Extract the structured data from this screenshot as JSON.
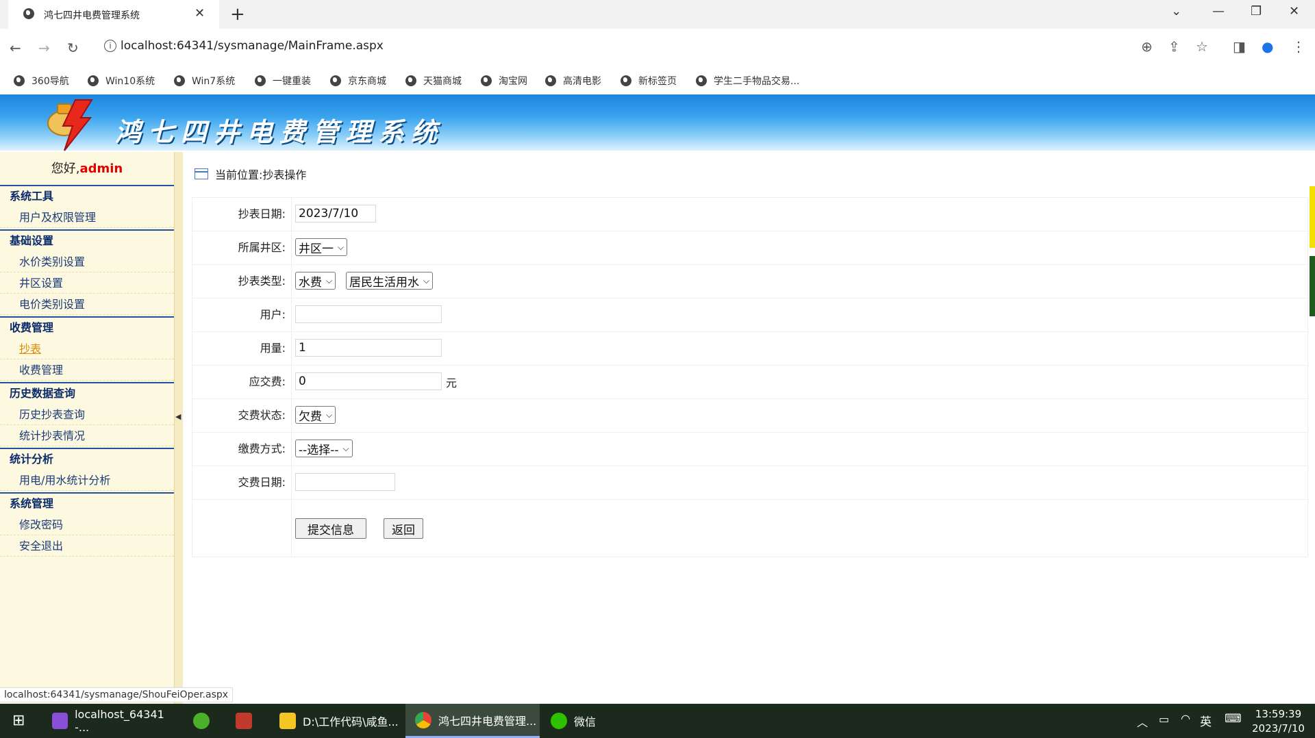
{
  "browser": {
    "tab_title": "鸿七四井电费管理系统",
    "url": "localhost:64341/sysmanage/MainFrame.aspx",
    "bookmarks": [
      "360导航",
      "Win10系统",
      "Win7系统",
      "一键重装",
      "京东商城",
      "天猫商城",
      "淘宝网",
      "高清电影",
      "新标签页",
      "学生二手物品交易..."
    ]
  },
  "header": {
    "system_title": "鸿七四井电费管理系统"
  },
  "sidebar": {
    "welcome_prefix": "您好,",
    "username": "admin",
    "groups": [
      {
        "title": "系统工具",
        "items": [
          "用户及权限管理"
        ]
      },
      {
        "title": "基础设置",
        "items": [
          "水价类别设置",
          "井区设置",
          "电价类别设置"
        ]
      },
      {
        "title": "收费管理",
        "items": [
          "抄表",
          "收费管理"
        ]
      },
      {
        "title": "历史数据查询",
        "items": [
          "历史抄表查询",
          "统计抄表情况"
        ]
      },
      {
        "title": "统计分析",
        "items": [
          "用电/用水统计分析"
        ]
      },
      {
        "title": "系统管理",
        "items": [
          "修改密码",
          "安全退出"
        ]
      }
    ],
    "active_item": "抄表"
  },
  "content": {
    "breadcrumb": "当前位置:抄表操作",
    "form": {
      "date_label": "抄表日期:",
      "date_value": "2023/7/10",
      "area_label": "所属井区:",
      "area_value": "井区一",
      "type_label": "抄表类型:",
      "type_value": "水费",
      "subtype_value": "居民生活用水",
      "user_label": "用户:",
      "user_value": "",
      "amount_label": "用量:",
      "amount_value": "1",
      "fee_label": "应交费:",
      "fee_value": "0",
      "fee_unit": "元",
      "status_label": "交费状态:",
      "status_value": "欠费",
      "method_label": "缴费方式:",
      "method_value": "--选择--",
      "paydate_label": "交费日期:",
      "paydate_value": "",
      "submit_label": "提交信息",
      "back_label": "返回"
    }
  },
  "status_bar": "localhost:64341/sysmanage/ShouFeiOper.aspx",
  "taskbar": {
    "tasks": [
      "localhost_64341 -...",
      "D:\\工作代码\\咸鱼...",
      "鸿七四井电费管理...",
      "微信"
    ],
    "ime": "英",
    "time": "13:59:39",
    "date": "2023/7/10"
  }
}
